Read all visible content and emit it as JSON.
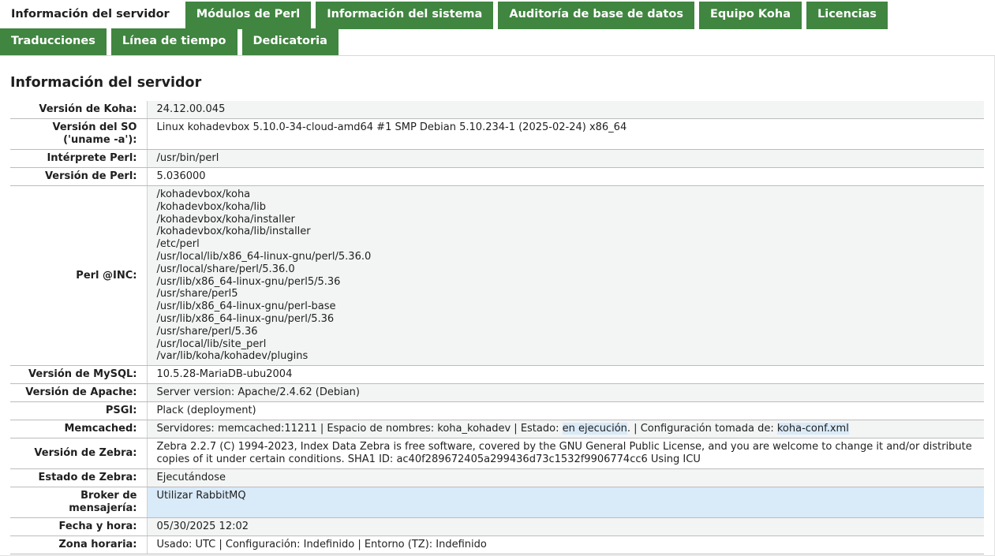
{
  "tabs": {
    "row1": [
      {
        "label": "Información del servidor",
        "active": true
      },
      {
        "label": "Módulos de Perl",
        "active": false
      },
      {
        "label": "Información del sistema",
        "active": false
      },
      {
        "label": "Auditoría de base de datos",
        "active": false
      },
      {
        "label": "Equipo Koha",
        "active": false
      },
      {
        "label": "Licencias",
        "active": false
      }
    ],
    "row2": [
      {
        "label": "Traducciones",
        "active": false
      },
      {
        "label": "Línea de tiempo",
        "active": false
      },
      {
        "label": "Dedicatoria",
        "active": false
      }
    ]
  },
  "colors": {
    "tab_bg": "#408540",
    "tab_text": "#ffffff",
    "highlight": "#d9eaf9"
  },
  "page": {
    "title": "Información del servidor"
  },
  "rows": {
    "koha_version": {
      "label": "Versión de Koha:",
      "value": "24.12.00.045"
    },
    "os_version": {
      "label1": "Versión del SO",
      "label2": "('uname -a'):",
      "value": "Linux kohadevbox 5.10.0-34-cloud-amd64 #1 SMP Debian 5.10.234-1 (2025-02-24) x86_64"
    },
    "perl_interpreter": {
      "label": "Intérprete Perl:",
      "value": "/usr/bin/perl"
    },
    "perl_version": {
      "label": "Versión de Perl:",
      "value": "5.036000"
    },
    "perl_inc": {
      "label": "Perl @INC:",
      "paths": [
        "/kohadevbox/koha",
        "/kohadevbox/koha/lib",
        "/kohadevbox/koha/installer",
        "/kohadevbox/koha/lib/installer",
        "/etc/perl",
        "/usr/local/lib/x86_64-linux-gnu/perl/5.36.0",
        "/usr/local/share/perl/5.36.0",
        "/usr/lib/x86_64-linux-gnu/perl5/5.36",
        "/usr/share/perl5",
        "/usr/lib/x86_64-linux-gnu/perl-base",
        "/usr/lib/x86_64-linux-gnu/perl/5.36",
        "/usr/share/perl/5.36",
        "/usr/local/lib/site_perl",
        "/var/lib/koha/kohadev/plugins"
      ]
    },
    "mysql_version": {
      "label": "Versión de MySQL:",
      "value": "10.5.28-MariaDB-ubu2004"
    },
    "apache_version": {
      "label": "Versión de Apache:",
      "value": "Server version: Apache/2.4.62 (Debian)"
    },
    "psgi": {
      "label": "PSGI:",
      "value": "Plack (deployment)"
    },
    "memcached": {
      "label": "Memcached:",
      "prefix": "Servidores: memcached:11211 | Espacio de nombres: koha_kohadev | Estado: ",
      "status": "en ejecución",
      "middle": ". | Configuración tomada de: ",
      "config_source": "koha-conf.xml"
    },
    "zebra_version": {
      "label": "Versión de Zebra:",
      "line1": "Zebra 2.2.7 (C) 1994-2023, Index Data Zebra is free software, covered by the GNU General Public License, and you are welcome to change it and/or distribute",
      "line2": "copies of it under certain conditions. SHA1 ID: ac40f289672405a299436d73c1532f9906774cc6 Using ICU"
    },
    "zebra_status": {
      "label": "Estado de Zebra:",
      "value": "Ejecutándose"
    },
    "message_broker": {
      "label1": "Broker de",
      "label2": "mensajería:",
      "value": "Utilizar RabbitMQ"
    },
    "date_time": {
      "label": "Fecha y hora:",
      "value": "05/30/2025 12:02"
    },
    "timezone": {
      "label": "Zona horaria:",
      "value": "Usado: UTC | Configuración: Indefinido | Entorno (TZ): Indefinido"
    }
  }
}
